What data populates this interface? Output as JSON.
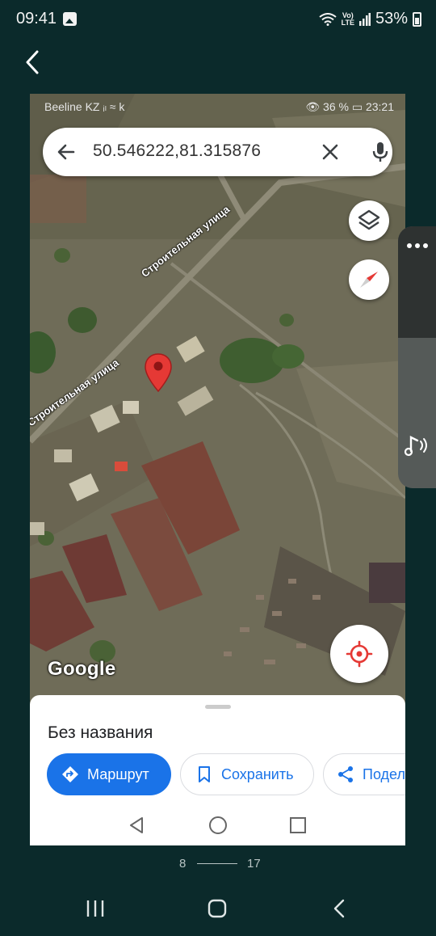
{
  "outer_status": {
    "time": "09:41",
    "battery": "53%",
    "volte_line1": "Vo)",
    "volte_line2": "LTE"
  },
  "pager": {
    "current": "8",
    "total": "17"
  },
  "inner_status": {
    "carrier": "Beeline KZ  ᵢₗ ≈ k",
    "right": "👁 36 %  ▭  23:21"
  },
  "search": {
    "query": "50.546222,81.315876"
  },
  "map": {
    "street_labels": [
      "Строительная улица",
      "Строительная улица"
    ],
    "logo": "Google"
  },
  "sheet": {
    "title": "Без названия",
    "route_label": "Маршрут",
    "save_label": "Сохранить",
    "share_label": "Подел"
  },
  "colors": {
    "outer_background": "#0b2a2b",
    "accent_blue": "#1a73e8",
    "pin_red": "#e53935"
  },
  "icons": [
    "gallery-icon",
    "wifi-icon",
    "signal-icon",
    "battery-icon",
    "back-arrow-icon",
    "search-back-icon",
    "clear-icon",
    "mic-icon",
    "layers-icon",
    "compass-icon",
    "locate-icon",
    "map-pin-icon",
    "directions-icon",
    "bookmark-icon",
    "share-icon",
    "more-icon",
    "music-icon"
  ]
}
